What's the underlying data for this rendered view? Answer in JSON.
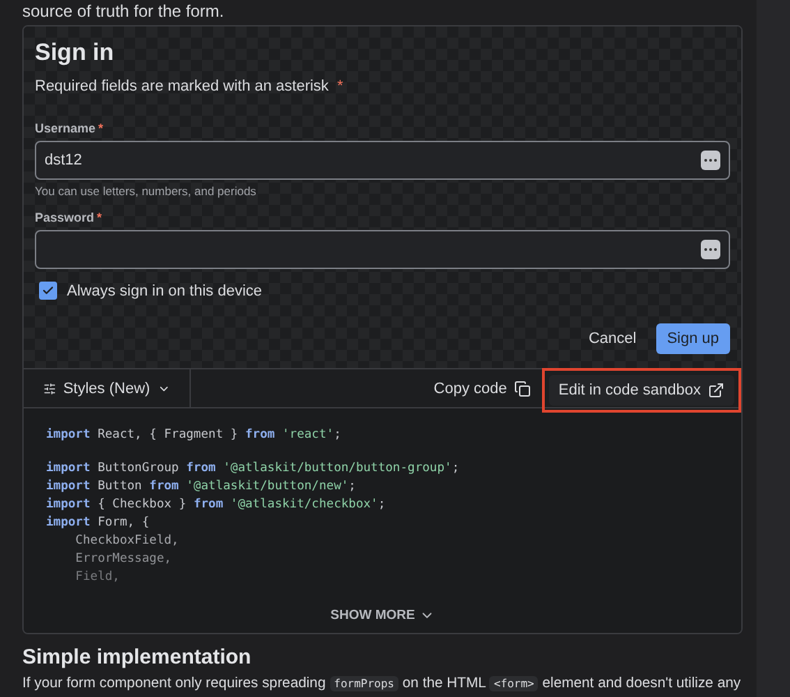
{
  "intro": "source of truth for the form.",
  "form": {
    "title": "Sign in",
    "required_note": "Required fields are marked with an asterisk",
    "required_mark": "*",
    "fields": [
      {
        "label": "Username",
        "required": true,
        "value": "dst12",
        "helper": "You can use letters, numbers, and periods"
      },
      {
        "label": "Password",
        "required": true
      }
    ],
    "checkbox": {
      "label": "Always sign in on this device",
      "checked": true
    },
    "buttons": [
      {
        "label": "Cancel",
        "kind": "subtle"
      },
      {
        "label": "Sign up",
        "kind": "primary"
      }
    ]
  },
  "toolbar": {
    "styles": "Styles (New)",
    "copy": "Copy code",
    "sandbox": "Edit in code sandbox",
    "sandbox_highlighted": true
  },
  "code": [
    [
      [
        {
          "kind": "keyword",
          "text": "import"
        },
        {
          "kind": "plain",
          "text": " React, { Fragment } "
        },
        {
          "kind": "keyword",
          "text": "from"
        },
        {
          "kind": "string",
          "text": " 'react'"
        },
        {
          "kind": "plain",
          "text": ";"
        }
      ]
    ],
    [
      [
        {
          "kind": "keyword",
          "text": "import"
        },
        {
          "kind": "plain",
          "text": " ButtonGroup "
        },
        {
          "kind": "keyword",
          "text": "from"
        },
        {
          "kind": "string",
          "text": " '@atlaskit/button/button-group'"
        },
        {
          "kind": "plain",
          "text": ";"
        }
      ],
      [
        {
          "kind": "keyword",
          "text": "import"
        },
        {
          "kind": "plain",
          "text": " Button "
        },
        {
          "kind": "keyword",
          "text": "from"
        },
        {
          "kind": "string",
          "text": " '@atlaskit/button/new'"
        },
        {
          "kind": "plain",
          "text": ";"
        }
      ],
      [
        {
          "kind": "keyword",
          "text": "import"
        },
        {
          "kind": "plain",
          "text": " { Checkbox } "
        },
        {
          "kind": "keyword",
          "text": "from"
        },
        {
          "kind": "string",
          "text": " '@atlaskit/checkbox'"
        },
        {
          "kind": "plain",
          "text": ";"
        }
      ],
      [
        {
          "kind": "keyword",
          "text": "import"
        },
        {
          "kind": "plain",
          "text": " Form, {"
        }
      ],
      [
        {
          "kind": "plain",
          "text": "    CheckboxField,"
        }
      ],
      [
        {
          "kind": "plain",
          "text": "    ErrorMessage,"
        }
      ],
      [
        {
          "kind": "plain",
          "text": "    Field,"
        }
      ]
    ]
  ],
  "show_more": "SHOW MORE",
  "section": {
    "heading": "Simple implementation",
    "paragraph": [
      {
        "kind": "text",
        "text": "If your form component only requires spreading "
      },
      {
        "kind": "code",
        "text": "formProps"
      },
      {
        "kind": "text",
        "text": " on the HTML "
      },
      {
        "kind": "code",
        "text": "<form>"
      },
      {
        "kind": "text",
        "text": " element and doesn't utilize any"
      }
    ]
  }
}
